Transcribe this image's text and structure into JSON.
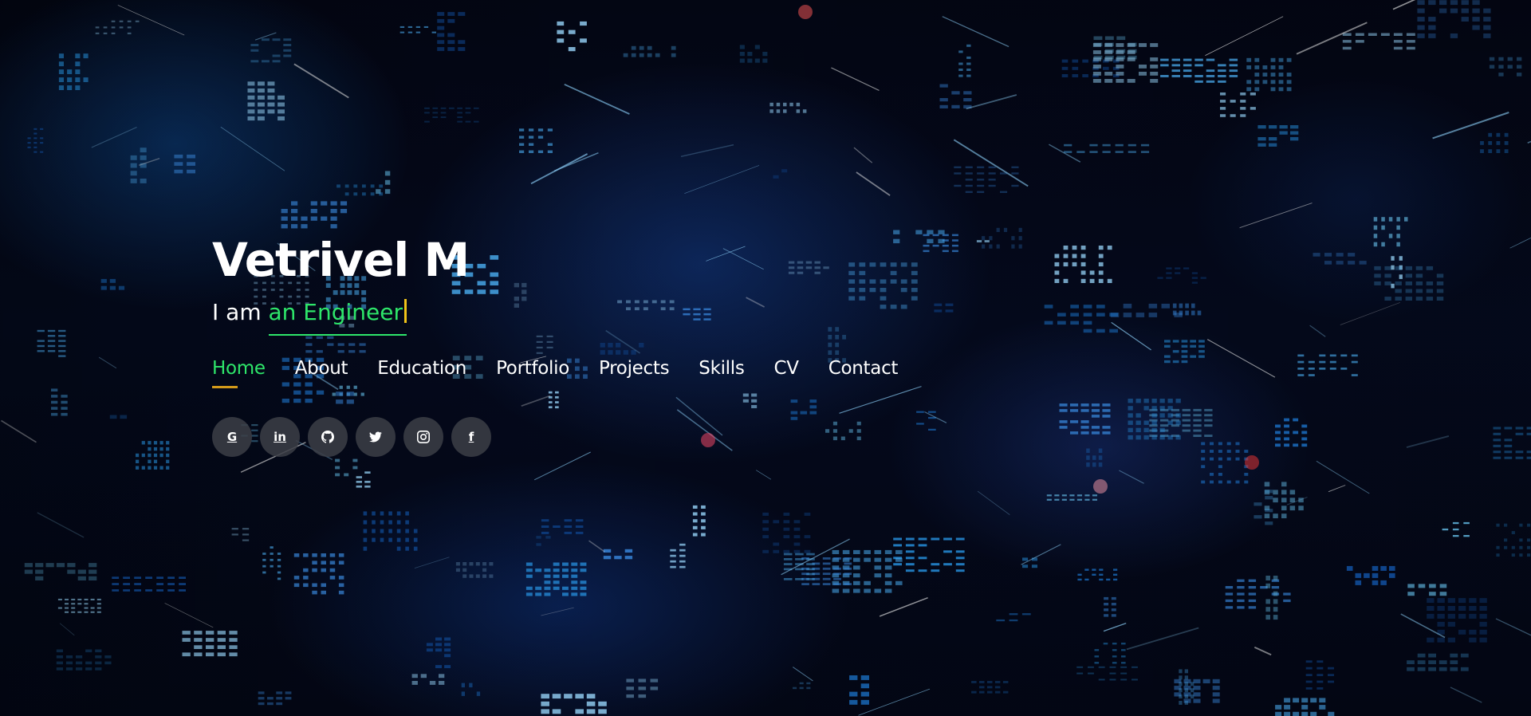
{
  "hero": {
    "name": "Vetrivel M",
    "tagline_prefix": "I am",
    "typed_text": "an Engineer",
    "accent_color": "#2ee66a",
    "cursor_color": "#f0c419"
  },
  "nav": {
    "items": [
      {
        "label": "Home",
        "active": true
      },
      {
        "label": "About"
      },
      {
        "label": "Education"
      },
      {
        "label": "Portfolio"
      },
      {
        "label": "Projects"
      },
      {
        "label": "Skills"
      },
      {
        "label": "CV"
      },
      {
        "label": "Contact"
      }
    ],
    "active_underline_color": "#d39a1a"
  },
  "socials": [
    {
      "icon": "google-icon",
      "glyph": "G"
    },
    {
      "icon": "linkedin-icon",
      "glyph": "in"
    },
    {
      "icon": "github-icon"
    },
    {
      "icon": "twitter-icon"
    },
    {
      "icon": "instagram-icon"
    },
    {
      "icon": "facebook-icon",
      "glyph": "f"
    }
  ]
}
